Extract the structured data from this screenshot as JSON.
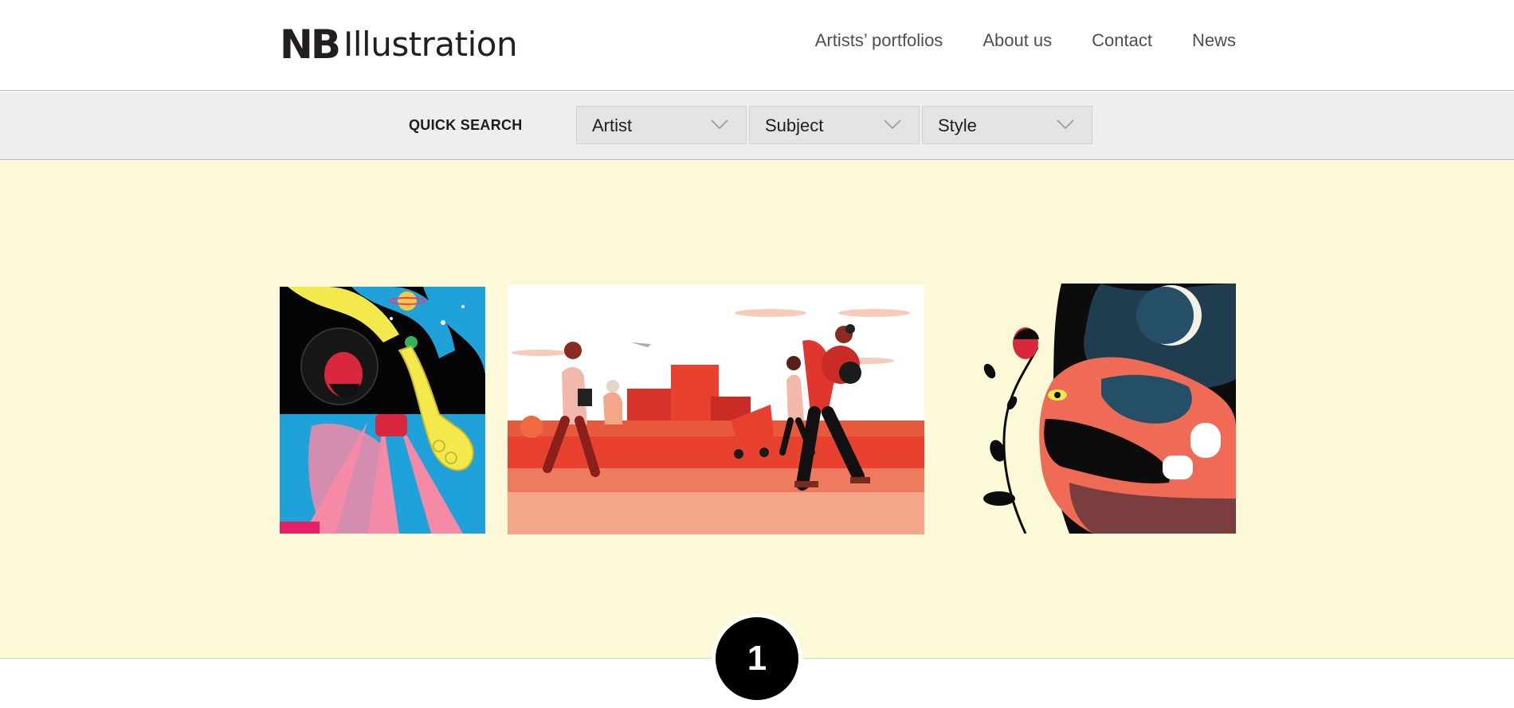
{
  "brand": {
    "logo_mark": "NB",
    "logo_word": "Illustration"
  },
  "nav": {
    "items": [
      {
        "label": "Artists’ portfolios"
      },
      {
        "label": "About us"
      },
      {
        "label": "Contact"
      },
      {
        "label": "News"
      }
    ]
  },
  "quick_search": {
    "label": "QUICK SEARCH",
    "filters": [
      {
        "value": "Artist",
        "icon": "chevron-down-icon"
      },
      {
        "value": "Subject",
        "icon": "chevron-down-icon"
      },
      {
        "value": "Style",
        "icon": "chevron-down-icon"
      }
    ]
  },
  "hero": {
    "background": "#fcf9d9",
    "illustrations": [
      {
        "subject": "saxophone player with cosmic swirls"
      },
      {
        "subject": "people walking past red city buildings"
      },
      {
        "subject": "abstract face with flower and moon"
      }
    ]
  },
  "pagination": {
    "current": "1"
  },
  "colors": {
    "accent_red": "#e8412f",
    "text_dark": "#231f20",
    "nav_gray": "#4e4e4e"
  }
}
